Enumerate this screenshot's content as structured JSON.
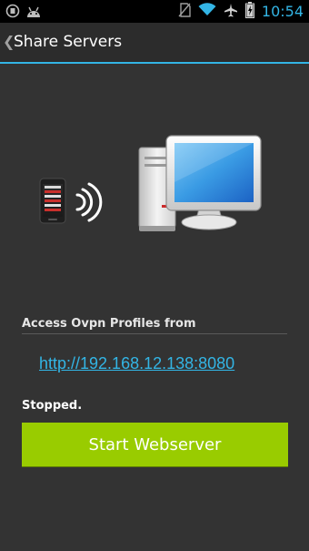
{
  "status_bar": {
    "time": "10:54",
    "icons": [
      "notification-icon",
      "android-icon",
      "no-sim-icon",
      "wifi-icon",
      "airplane-icon",
      "battery-charging-icon"
    ]
  },
  "action_bar": {
    "back_glyph": "❮",
    "title": "Share Servers"
  },
  "illustration": {
    "icons": [
      "phone-icon",
      "wireless-signal-icon",
      "desktop-computer-icon"
    ]
  },
  "content": {
    "section_label": "Access Ovpn Profiles from",
    "url": "http://192.168.12.138:8080",
    "status": "Stopped.",
    "button_label": "Start Webserver"
  },
  "colors": {
    "accent": "#33b5e5",
    "button": "#99cc00",
    "background": "#333333",
    "status_bar": "#000000"
  }
}
